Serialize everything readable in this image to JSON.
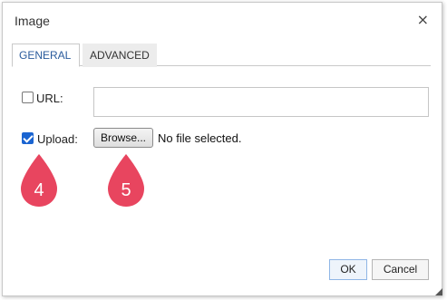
{
  "dialog": {
    "title": "Image",
    "close_glyph": "×"
  },
  "tabs": [
    {
      "label": "GENERAL",
      "active": true
    },
    {
      "label": "ADVANCED",
      "active": false
    }
  ],
  "url_option": {
    "label": "URL:",
    "checked": false,
    "input_value": ""
  },
  "upload_option": {
    "label": "Upload:",
    "checked": true,
    "browse_label": "Browse...",
    "file_status": "No file selected."
  },
  "markers": [
    {
      "number": "4",
      "color": "#e8455f"
    },
    {
      "number": "5",
      "color": "#e8455f"
    }
  ],
  "footer": {
    "ok_label": "OK",
    "cancel_label": "Cancel"
  },
  "colors": {
    "accent": "#1a64d1",
    "tab_active_text": "#2a5b9c",
    "marker": "#e8455f"
  }
}
